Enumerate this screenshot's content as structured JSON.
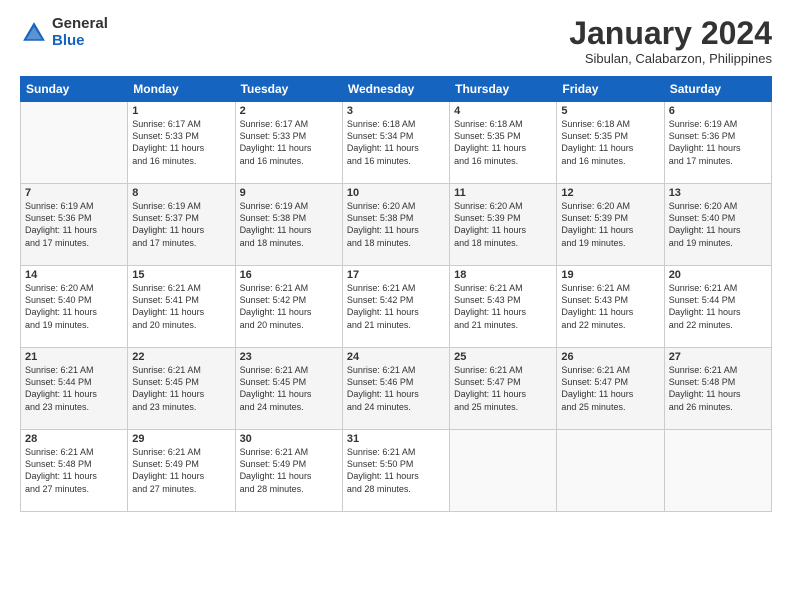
{
  "header": {
    "logo_general": "General",
    "logo_blue": "Blue",
    "month_title": "January 2024",
    "subtitle": "Sibulan, Calabarzon, Philippines"
  },
  "days_of_week": [
    "Sunday",
    "Monday",
    "Tuesday",
    "Wednesday",
    "Thursday",
    "Friday",
    "Saturday"
  ],
  "weeks": [
    [
      {
        "day": "",
        "info": ""
      },
      {
        "day": "1",
        "info": "Sunrise: 6:17 AM\nSunset: 5:33 PM\nDaylight: 11 hours\nand 16 minutes."
      },
      {
        "day": "2",
        "info": "Sunrise: 6:17 AM\nSunset: 5:33 PM\nDaylight: 11 hours\nand 16 minutes."
      },
      {
        "day": "3",
        "info": "Sunrise: 6:18 AM\nSunset: 5:34 PM\nDaylight: 11 hours\nand 16 minutes."
      },
      {
        "day": "4",
        "info": "Sunrise: 6:18 AM\nSunset: 5:35 PM\nDaylight: 11 hours\nand 16 minutes."
      },
      {
        "day": "5",
        "info": "Sunrise: 6:18 AM\nSunset: 5:35 PM\nDaylight: 11 hours\nand 16 minutes."
      },
      {
        "day": "6",
        "info": "Sunrise: 6:19 AM\nSunset: 5:36 PM\nDaylight: 11 hours\nand 17 minutes."
      }
    ],
    [
      {
        "day": "7",
        "info": "Sunrise: 6:19 AM\nSunset: 5:36 PM\nDaylight: 11 hours\nand 17 minutes."
      },
      {
        "day": "8",
        "info": "Sunrise: 6:19 AM\nSunset: 5:37 PM\nDaylight: 11 hours\nand 17 minutes."
      },
      {
        "day": "9",
        "info": "Sunrise: 6:19 AM\nSunset: 5:38 PM\nDaylight: 11 hours\nand 18 minutes."
      },
      {
        "day": "10",
        "info": "Sunrise: 6:20 AM\nSunset: 5:38 PM\nDaylight: 11 hours\nand 18 minutes."
      },
      {
        "day": "11",
        "info": "Sunrise: 6:20 AM\nSunset: 5:39 PM\nDaylight: 11 hours\nand 18 minutes."
      },
      {
        "day": "12",
        "info": "Sunrise: 6:20 AM\nSunset: 5:39 PM\nDaylight: 11 hours\nand 19 minutes."
      },
      {
        "day": "13",
        "info": "Sunrise: 6:20 AM\nSunset: 5:40 PM\nDaylight: 11 hours\nand 19 minutes."
      }
    ],
    [
      {
        "day": "14",
        "info": "Sunrise: 6:20 AM\nSunset: 5:40 PM\nDaylight: 11 hours\nand 19 minutes."
      },
      {
        "day": "15",
        "info": "Sunrise: 6:21 AM\nSunset: 5:41 PM\nDaylight: 11 hours\nand 20 minutes."
      },
      {
        "day": "16",
        "info": "Sunrise: 6:21 AM\nSunset: 5:42 PM\nDaylight: 11 hours\nand 20 minutes."
      },
      {
        "day": "17",
        "info": "Sunrise: 6:21 AM\nSunset: 5:42 PM\nDaylight: 11 hours\nand 21 minutes."
      },
      {
        "day": "18",
        "info": "Sunrise: 6:21 AM\nSunset: 5:43 PM\nDaylight: 11 hours\nand 21 minutes."
      },
      {
        "day": "19",
        "info": "Sunrise: 6:21 AM\nSunset: 5:43 PM\nDaylight: 11 hours\nand 22 minutes."
      },
      {
        "day": "20",
        "info": "Sunrise: 6:21 AM\nSunset: 5:44 PM\nDaylight: 11 hours\nand 22 minutes."
      }
    ],
    [
      {
        "day": "21",
        "info": "Sunrise: 6:21 AM\nSunset: 5:44 PM\nDaylight: 11 hours\nand 23 minutes."
      },
      {
        "day": "22",
        "info": "Sunrise: 6:21 AM\nSunset: 5:45 PM\nDaylight: 11 hours\nand 23 minutes."
      },
      {
        "day": "23",
        "info": "Sunrise: 6:21 AM\nSunset: 5:45 PM\nDaylight: 11 hours\nand 24 minutes."
      },
      {
        "day": "24",
        "info": "Sunrise: 6:21 AM\nSunset: 5:46 PM\nDaylight: 11 hours\nand 24 minutes."
      },
      {
        "day": "25",
        "info": "Sunrise: 6:21 AM\nSunset: 5:47 PM\nDaylight: 11 hours\nand 25 minutes."
      },
      {
        "day": "26",
        "info": "Sunrise: 6:21 AM\nSunset: 5:47 PM\nDaylight: 11 hours\nand 25 minutes."
      },
      {
        "day": "27",
        "info": "Sunrise: 6:21 AM\nSunset: 5:48 PM\nDaylight: 11 hours\nand 26 minutes."
      }
    ],
    [
      {
        "day": "28",
        "info": "Sunrise: 6:21 AM\nSunset: 5:48 PM\nDaylight: 11 hours\nand 27 minutes."
      },
      {
        "day": "29",
        "info": "Sunrise: 6:21 AM\nSunset: 5:49 PM\nDaylight: 11 hours\nand 27 minutes."
      },
      {
        "day": "30",
        "info": "Sunrise: 6:21 AM\nSunset: 5:49 PM\nDaylight: 11 hours\nand 28 minutes."
      },
      {
        "day": "31",
        "info": "Sunrise: 6:21 AM\nSunset: 5:50 PM\nDaylight: 11 hours\nand 28 minutes."
      },
      {
        "day": "",
        "info": ""
      },
      {
        "day": "",
        "info": ""
      },
      {
        "day": "",
        "info": ""
      }
    ]
  ]
}
